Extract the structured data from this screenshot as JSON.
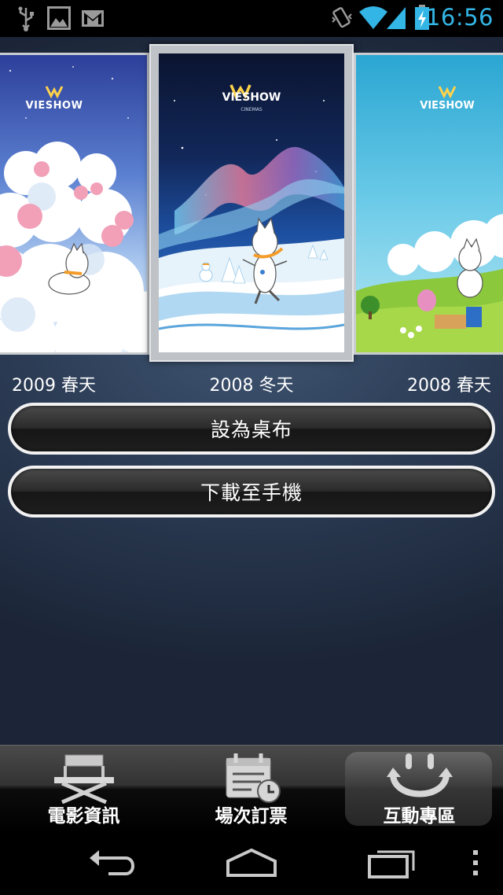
{
  "status_bar": {
    "time": "16:56",
    "left_icons": [
      "usb-icon",
      "image-icon",
      "gmail-icon"
    ],
    "right_icons": [
      "vibrate-icon",
      "wifi-icon",
      "signal-icon",
      "battery-charging-icon"
    ],
    "accent_color": "#33b5e5"
  },
  "gallery": {
    "brand": "VIESHOW",
    "brand_sub": "CINEMAS",
    "wallpapers": [
      {
        "label": "2009 春天"
      },
      {
        "label": "2008 冬天"
      },
      {
        "label": "2008 春天"
      }
    ]
  },
  "actions": {
    "set_wallpaper": "設為桌布",
    "download": "下載至手機"
  },
  "tabs": [
    {
      "label": "電影資訊",
      "icon": "director-chair-icon",
      "selected": false
    },
    {
      "label": "場次訂票",
      "icon": "calendar-clock-icon",
      "selected": false
    },
    {
      "label": "互動專區",
      "icon": "smiley-refresh-icon",
      "selected": true
    }
  ],
  "nav": {
    "icons": [
      "back-icon",
      "home-icon",
      "recent-apps-icon",
      "menu-icon"
    ]
  }
}
